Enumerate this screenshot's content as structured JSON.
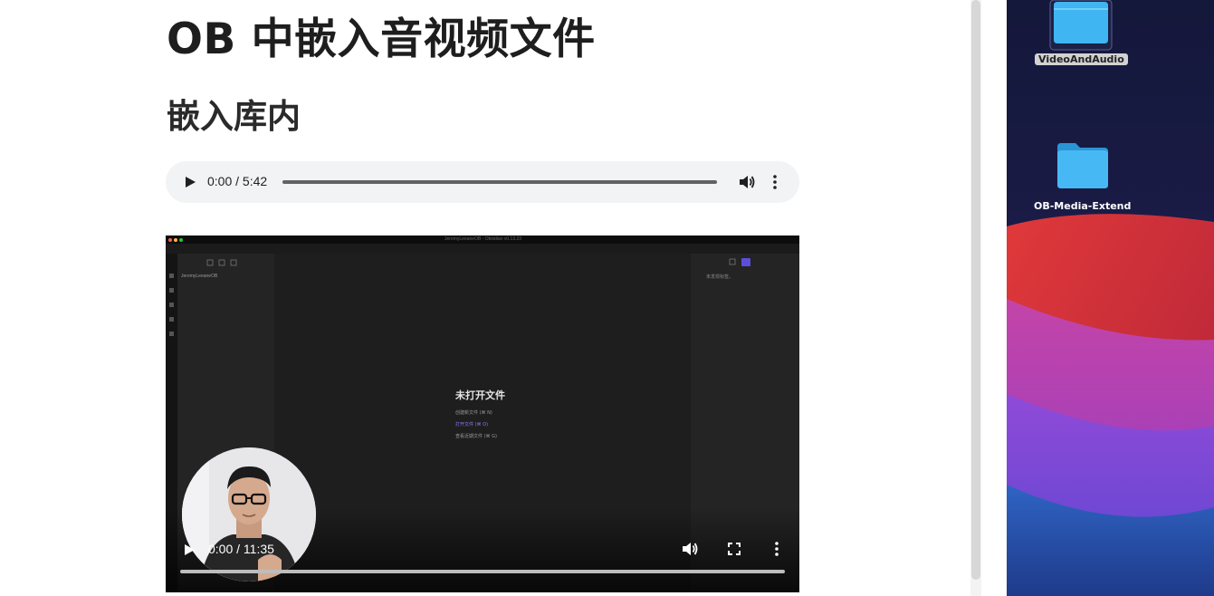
{
  "note": {
    "title": "OB 中嵌入音视频文件",
    "subtitle": "嵌入库内"
  },
  "audio_player": {
    "time": "0:00 / 5:42"
  },
  "video_player": {
    "time": "0:00 / 11:35",
    "screen": {
      "window_title": "JeremyLeeaneOB - Obsidian v0.13.23",
      "vault_name": "JeremyLeeaneOB",
      "right_panel_text": "未发现标签。",
      "empty_state_title": "未打开文件",
      "empty_state_links": [
        "创建新文件 (⌘ N)",
        "打开文件 (⌘ O)",
        "查看近期文件 (⌘ G)"
      ]
    }
  },
  "desktop": {
    "folders": [
      {
        "label": "VideoAndAudio"
      },
      {
        "label": "OB-Media-Extend"
      }
    ]
  },
  "colors": {
    "folder_blue": "#3fb5f2",
    "accent_purple": "#7c6cf2",
    "audio_bg": "#f1f3f4"
  }
}
